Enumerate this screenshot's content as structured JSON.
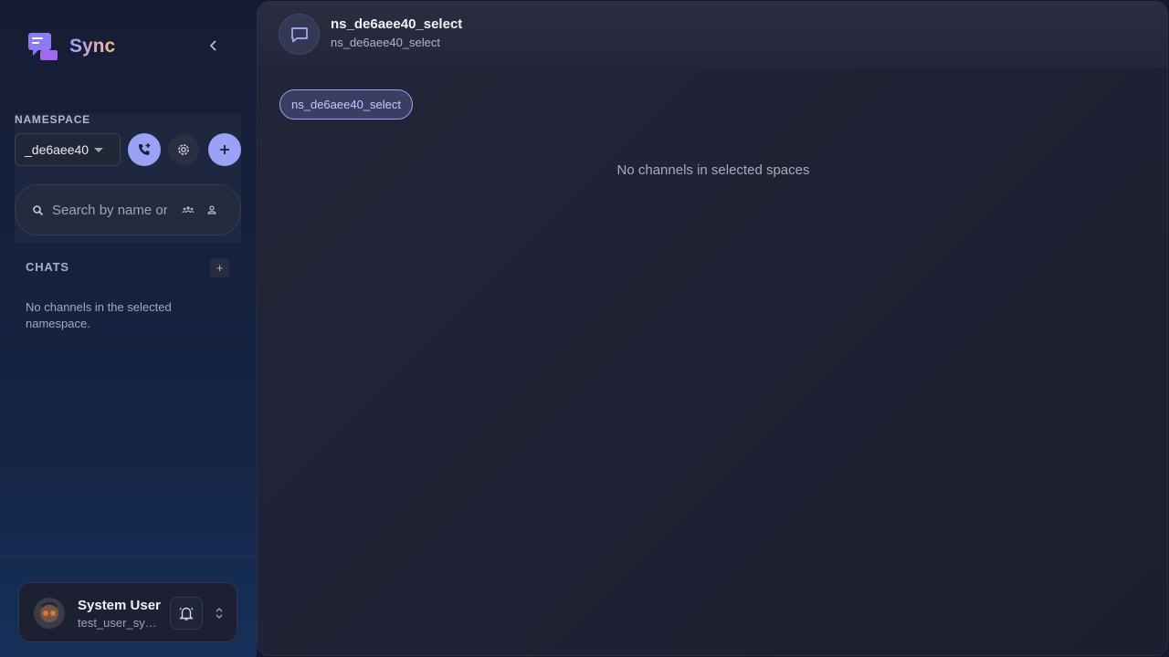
{
  "brand": {
    "name": "Sync"
  },
  "sidebar": {
    "namespace": {
      "label": "NAMESPACE",
      "selected": "_de6aee40"
    },
    "search": {
      "placeholder": "Search by name or"
    },
    "chats": {
      "header": "CHATS",
      "add_label": "+",
      "empty_text": "No channels in the selected namespace."
    },
    "user": {
      "name": "System User",
      "handle": "test_user_system"
    }
  },
  "main": {
    "channel_title": "ns_de6aee40_select",
    "channel_subtitle": "ns_de6aee40_select",
    "space_chip": "ns_de6aee40_select",
    "empty_text": "No channels in selected spaces"
  },
  "colors": {
    "accent": "#9aa2f6",
    "sidebar_bg": "#161c33",
    "main_bg": "#1f2234"
  },
  "icons": [
    "chat-bubbles-logo",
    "chevron-left-icon",
    "phone-add-icon",
    "gear-icon",
    "plus-icon",
    "search-icon",
    "group-icon",
    "person-icon",
    "bell-icon",
    "chevron-updown-icon",
    "message-icon"
  ]
}
